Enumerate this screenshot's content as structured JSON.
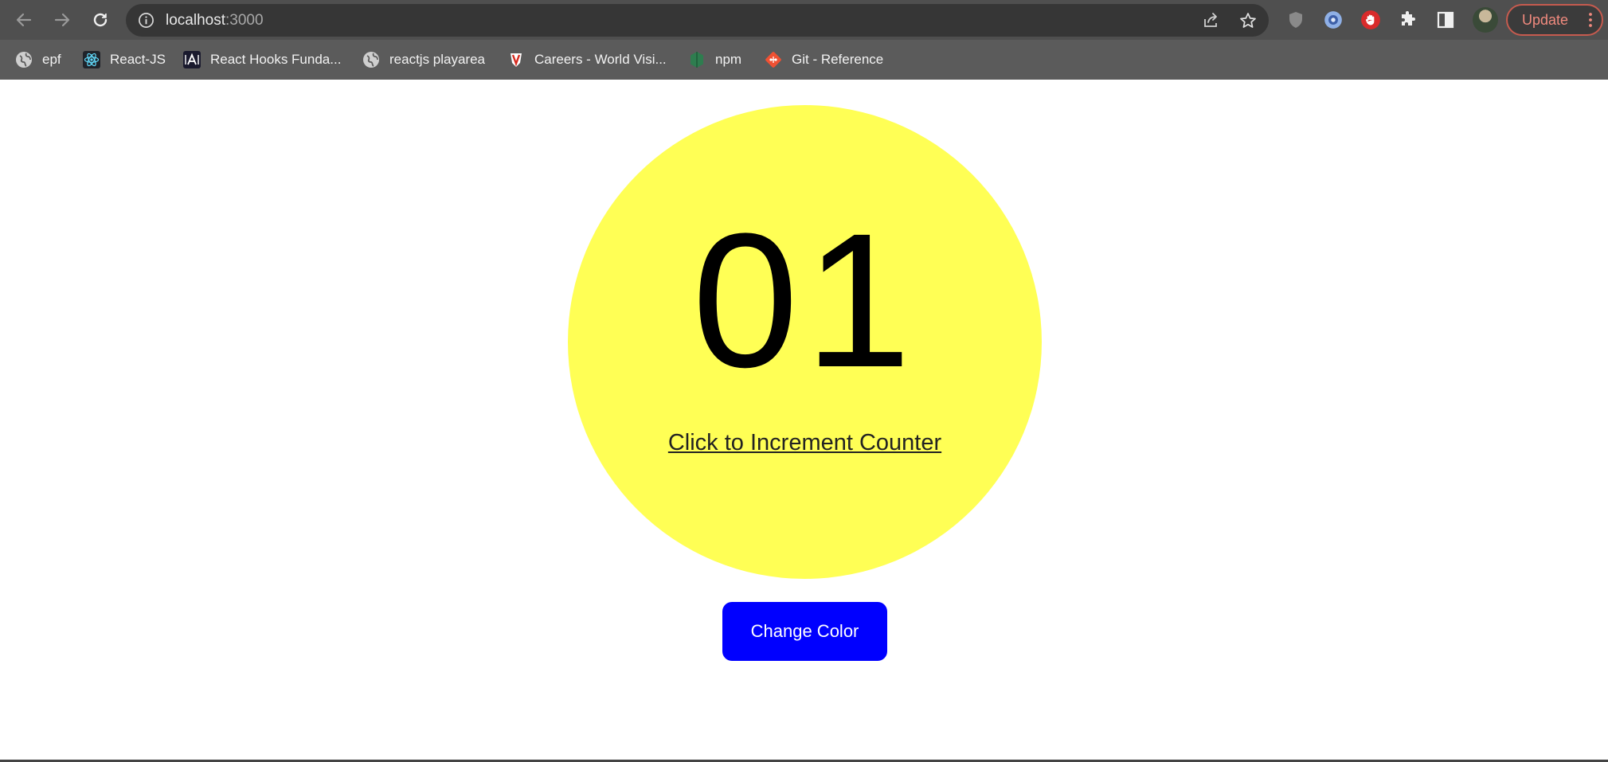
{
  "browser": {
    "url_host": "localhost",
    "url_port": ":3000",
    "update_label": "Update"
  },
  "bookmarks": [
    {
      "label": "epf",
      "icon": "globe-icon"
    },
    {
      "label": "React-JS",
      "icon": "react-icon"
    },
    {
      "label": "React Hooks Funda...",
      "icon": "react-hooks-icon"
    },
    {
      "label": "reactjs playarea",
      "icon": "globe-icon"
    },
    {
      "label": "Careers - World Visi...",
      "icon": "world-vision-icon"
    },
    {
      "label": "npm",
      "icon": "npm-icon"
    },
    {
      "label": "Git - Reference",
      "icon": "git-icon"
    }
  ],
  "counter": {
    "value": "01",
    "link_label": "Click to Increment Counter",
    "circle_color": "#ffff55"
  },
  "actions": {
    "change_color_label": "Change Color",
    "button_color": "#0000ff"
  }
}
